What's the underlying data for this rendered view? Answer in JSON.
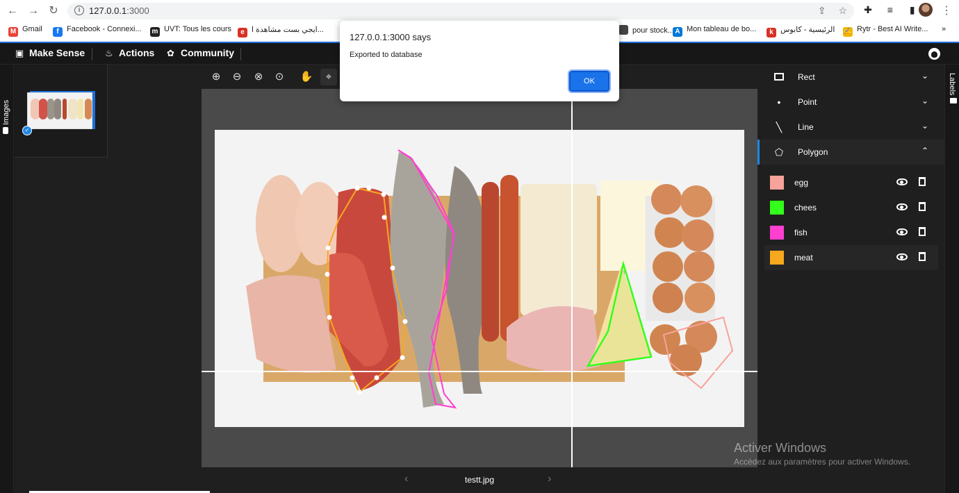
{
  "browser": {
    "url_host": "127.0.0.1",
    "url_port": ":3000",
    "bookmarks": [
      {
        "label": "Gmail",
        "icon": "gmail-icon",
        "color": "#ea4335",
        "glyph": "M"
      },
      {
        "label": "Facebook - Connexi...",
        "icon": "facebook-icon",
        "color": "#1877f2",
        "glyph": "f"
      },
      {
        "label": "UVT: Tous les cours",
        "icon": "moodle-icon",
        "color": "#222222",
        "glyph": "m"
      },
      {
        "label": "ايجي بست مشاهدة ا...",
        "icon": "egybest-icon",
        "color": "#d93025",
        "glyph": "e"
      },
      {
        "label": "pour stock...",
        "icon": "bookmark-icon",
        "color": "#444444",
        "glyph": ""
      },
      {
        "label": "Mon tableau de bo...",
        "icon": "azure-icon",
        "color": "#0078d4",
        "glyph": "A"
      },
      {
        "label": "الرئيسية - كابوس",
        "icon": "kabous-icon",
        "color": "#d93025",
        "glyph": "k"
      },
      {
        "label": "Rytr - Best AI Write...",
        "icon": "rytr-icon",
        "color": "#f4b400",
        "glyph": "✍"
      }
    ],
    "overflow": "»"
  },
  "appbar": {
    "brand": "Make Sense",
    "actions": "Actions",
    "community": "Community"
  },
  "left_tab": "Images",
  "right_tab": "Labels",
  "image_name": "testt.jpg",
  "tools": [
    {
      "label": "Rect",
      "icon": "rect-icon",
      "state": "collapsed"
    },
    {
      "label": "Point",
      "icon": "point-icon",
      "state": "collapsed"
    },
    {
      "label": "Line",
      "icon": "line-icon",
      "state": "collapsed"
    },
    {
      "label": "Polygon",
      "icon": "polygon-icon",
      "state": "expanded"
    }
  ],
  "labels": [
    {
      "name": "egg",
      "color": "#f7a29a"
    },
    {
      "name": "chees",
      "color": "#33ff1a"
    },
    {
      "name": "fish",
      "color": "#ff3fd0"
    },
    {
      "name": "meat",
      "color": "#f7a81e"
    }
  ],
  "dialog": {
    "title": "127.0.0.1:3000 says",
    "message": "Exported to database",
    "ok": "OK"
  },
  "watermark": {
    "line1": "Activer Windows",
    "line2": "Accédez aux paramètres pour activer Windows."
  }
}
